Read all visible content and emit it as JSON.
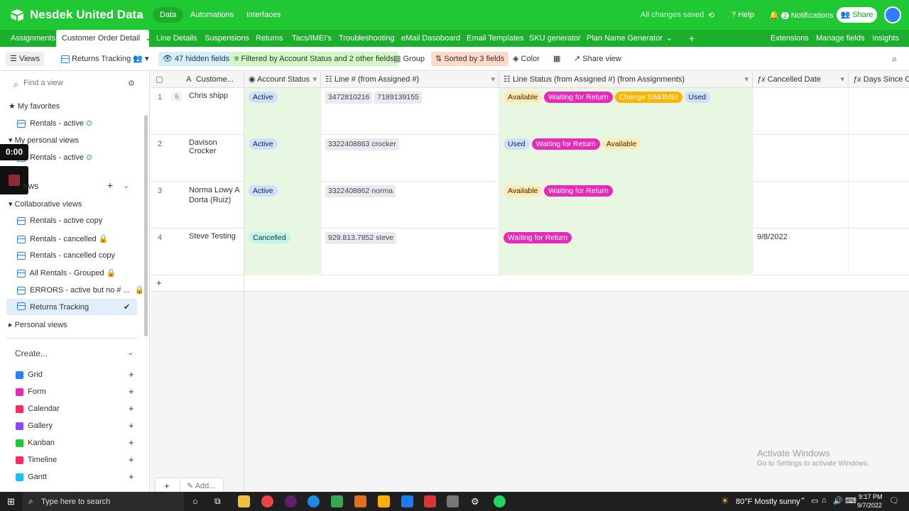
{
  "app": {
    "base_name": "Nesdek United Data",
    "nav": [
      "Data",
      "Automations",
      "Interfaces"
    ],
    "saved_status": "All changes saved",
    "help": "Help",
    "notifications_label": "Notifications",
    "notifications_count": "2",
    "share": "Share",
    "accent": "#20c933"
  },
  "tabs": [
    "Assignments",
    "Customer Order Detail",
    "Line Details",
    "Suspensions",
    "Returns",
    "Tacs/IMEI's",
    "Troubleshooting",
    "eMail Dasoboard",
    "Email Templates",
    "SKU generator",
    "Plan Name Generator"
  ],
  "tab_right": [
    "Extensions",
    "Manage fields",
    "Insights"
  ],
  "viewbar": {
    "views": "Views",
    "current_view": "Returns Tracking",
    "hidden": "47 hidden fields",
    "filter": "Filtered by Account Status and 2 other fields",
    "group": "Group",
    "sort": "Sorted by 3 fields",
    "color": "Color",
    "share_view": "Share view"
  },
  "sidebar": {
    "find_placeholder": "Find a view",
    "favorites": "My favorites",
    "fav_item": "Rentals - active",
    "personal": "My personal views",
    "personal_item": "Rentals - active",
    "timer": "0:00",
    "views_section": "ews",
    "collab": "Collaborative views",
    "collab_items": [
      "Rentals - active copy",
      "Rentals - cancelled",
      "Rentals - cancelled copy",
      "All Rentals - Grouped",
      "ERRORS - active but no # ...",
      "Returns Tracking"
    ],
    "personal_views": "Personal views",
    "create": "Create...",
    "create_items": [
      "Grid",
      "Form",
      "Calendar",
      "Gallery",
      "Kanban",
      "Timeline",
      "Gantt"
    ]
  },
  "columns": [
    "Custome...",
    "Account Status",
    "Line # (from Assigned #)",
    "Line Status (from Assigned #) (from Assignments)",
    "Cancelled Date",
    "Days Since Can"
  ],
  "rows": [
    {
      "num": "1",
      "badge": "6",
      "name": "Chris shipp",
      "status": "Active",
      "lines": [
        "3472810216",
        "7189139155"
      ],
      "line_status": [
        "Available",
        "Waiting for Return",
        "Change SIM/IMEI",
        "Used"
      ],
      "cancelled": ""
    },
    {
      "num": "2",
      "badge": "",
      "name": "Davison Crocker",
      "status": "Active",
      "lines": [
        "3322408863 crocker"
      ],
      "line_status": [
        "Used",
        "Waiting for Return",
        "Available"
      ],
      "cancelled": ""
    },
    {
      "num": "3",
      "badge": "",
      "name": "Norma Lowy A Dorta (Ruiz)",
      "status": "Active",
      "lines": [
        "3322408862 norma"
      ],
      "line_status": [
        "Available",
        "Waiting for Return"
      ],
      "cancelled": ""
    },
    {
      "num": "4",
      "badge": "",
      "name": "Steve Testing",
      "status": "Cancelled",
      "lines": [
        "929.813.7852 steve"
      ],
      "line_status": [
        "Waiting for Return"
      ],
      "cancelled": "9/8/2022"
    }
  ],
  "footer": {
    "add": "Add..."
  },
  "watermark": {
    "title": "Activate Windows",
    "sub": "Go to Settings to activate Windows."
  },
  "taskbar": {
    "search": "Type here to search",
    "weather": "80°F  Mostly sunny",
    "time": "9:17 PM",
    "date": "9/7/2022"
  }
}
